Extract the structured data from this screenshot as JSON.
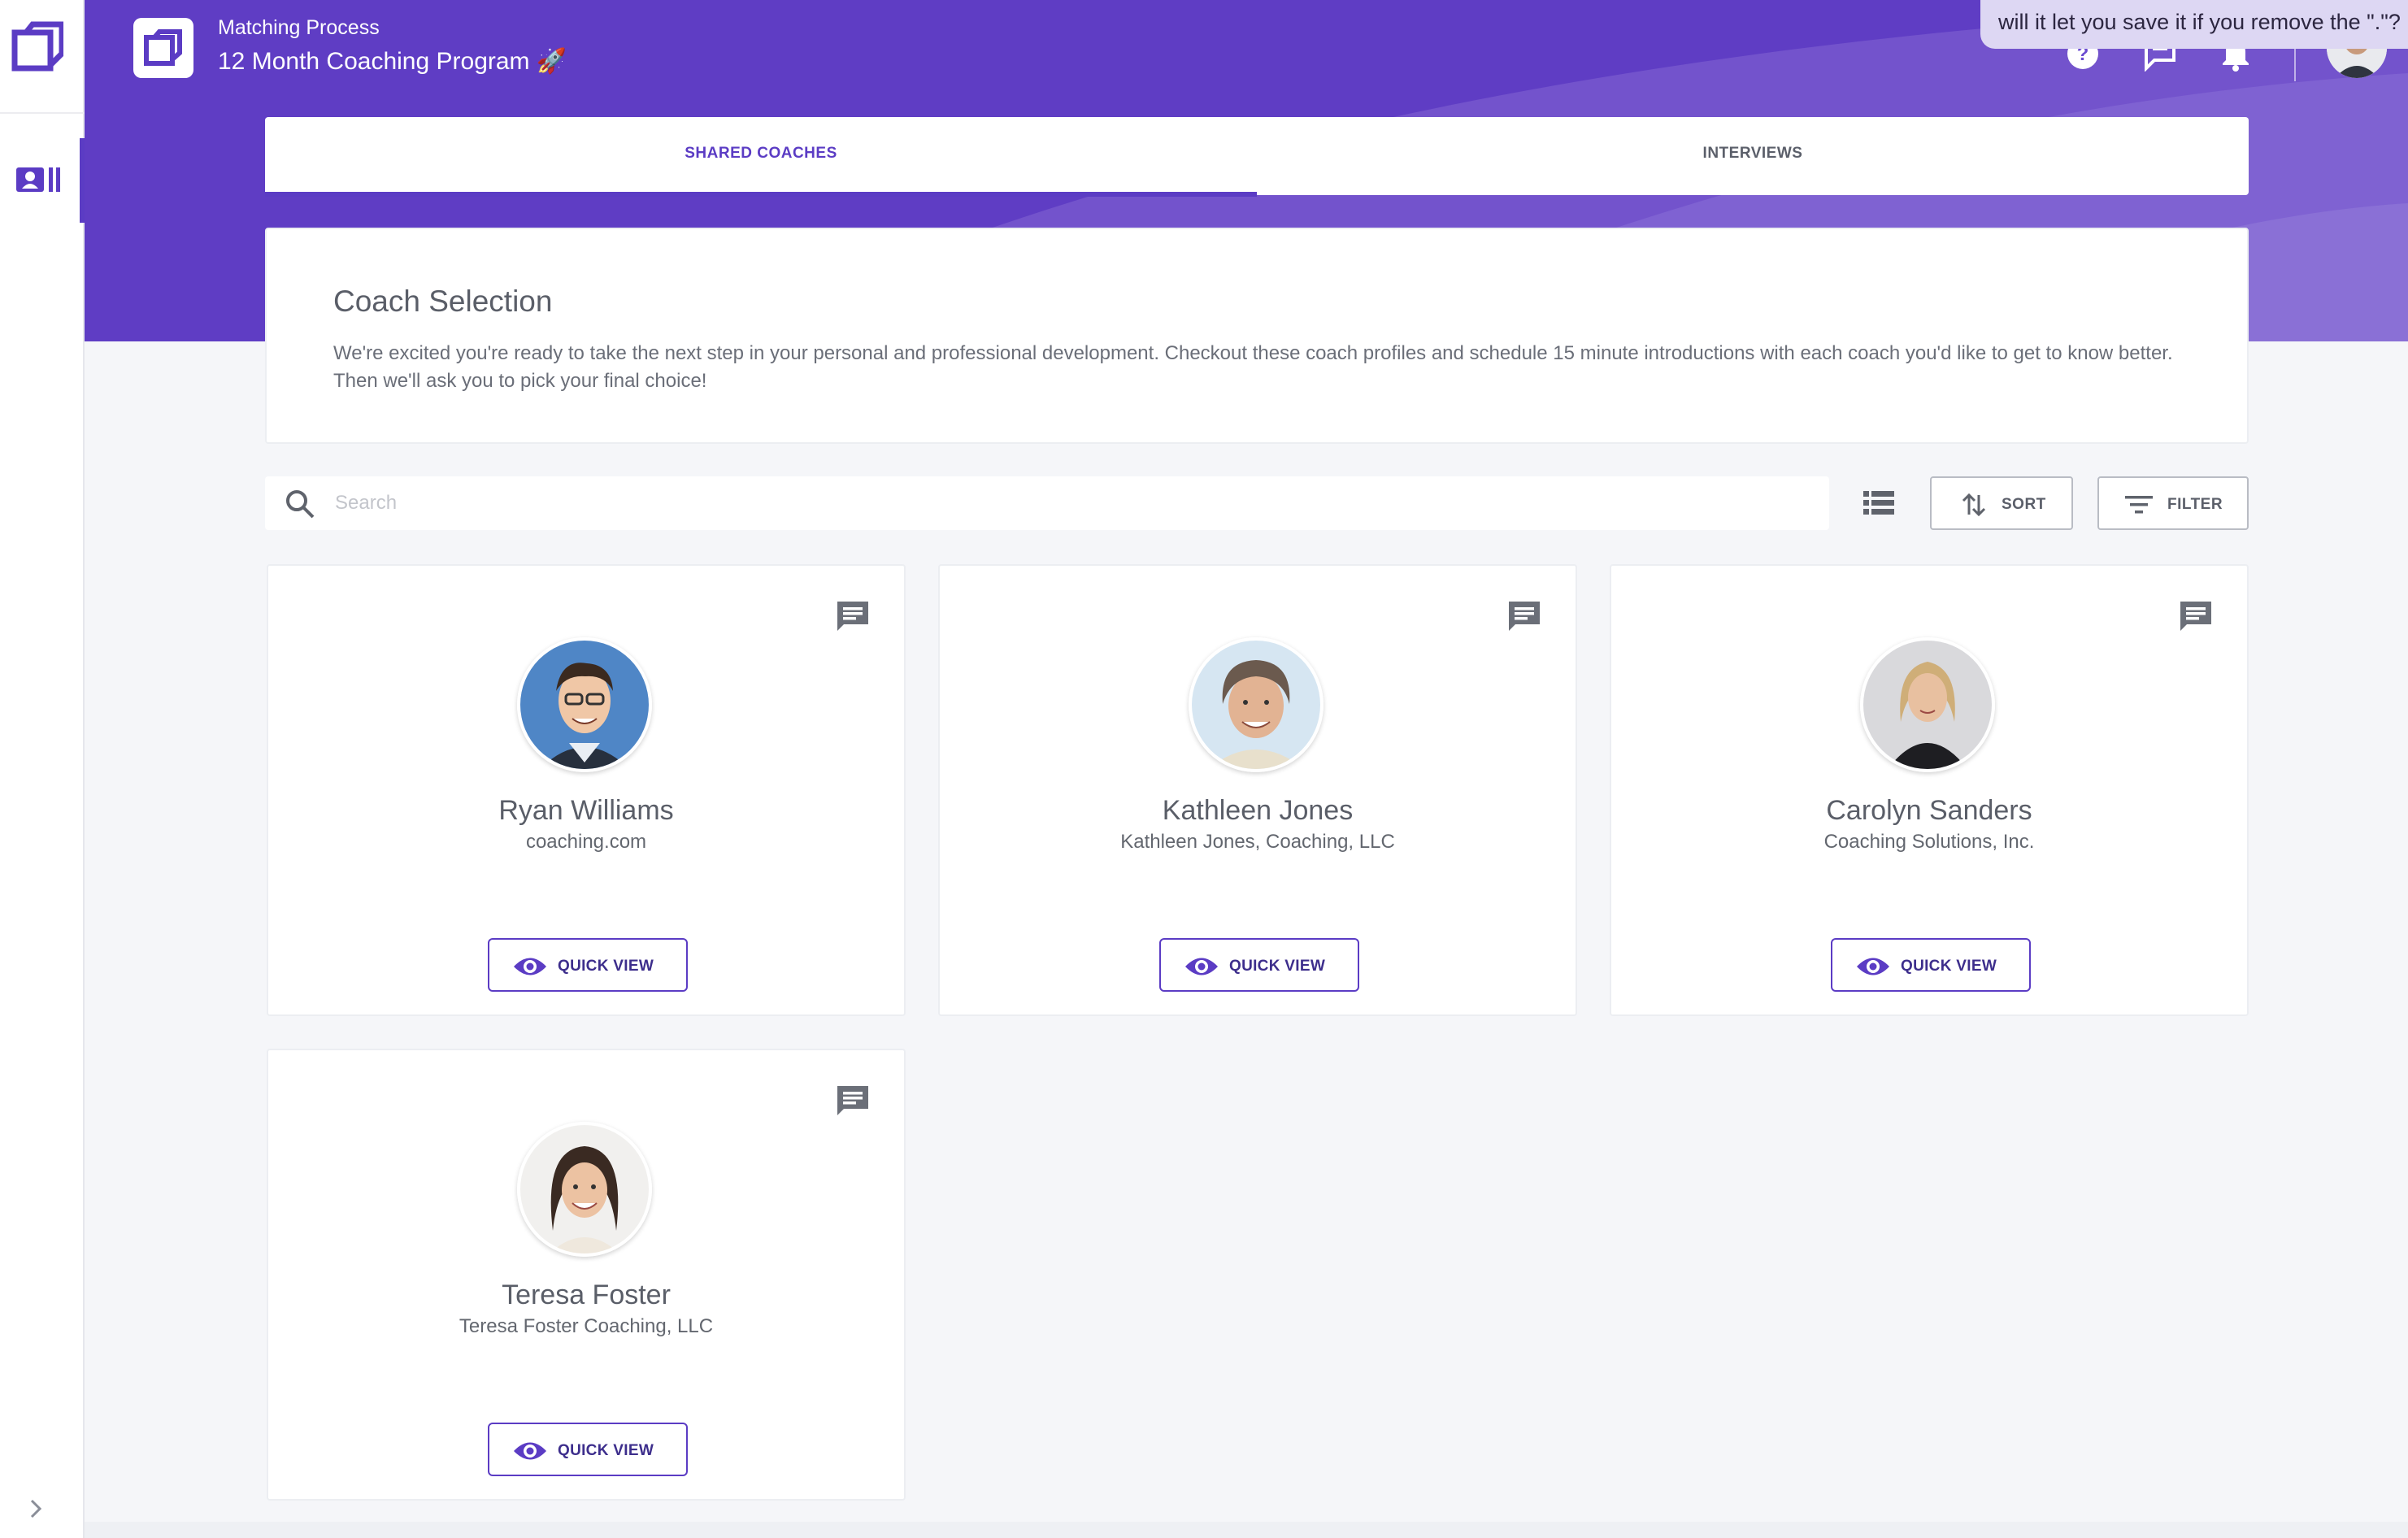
{
  "header": {
    "breadcrumb_sub": "Matching Process",
    "title": "12 Month Coaching Program 🚀",
    "brand_color": "#5f3dc4",
    "icons": [
      "help-icon",
      "chat-icon",
      "bell-icon"
    ]
  },
  "tooltip": {
    "text": "will it let you save it if you remove the \".\"?"
  },
  "tabs": [
    {
      "label": "SHARED COACHES",
      "active": true
    },
    {
      "label": "INTERVIEWS",
      "active": false
    }
  ],
  "intro": {
    "heading": "Coach Selection",
    "body": "We're excited you're ready to take the next step in your personal and professional development. Checkout these coach profiles and schedule 15 minute introductions with each coach you'd like to get to know better. Then we'll ask you to pick your final choice!"
  },
  "toolbar": {
    "search_placeholder": "Search",
    "sort_label": "SORT",
    "filter_label": "FILTER"
  },
  "coaches": [
    {
      "name": "Ryan Williams",
      "company": "coaching.com",
      "quick_view_label": "QUICK VIEW"
    },
    {
      "name": "Kathleen Jones",
      "company": "Kathleen Jones, Coaching, LLC",
      "quick_view_label": "QUICK VIEW"
    },
    {
      "name": "Carolyn Sanders",
      "company": "Coaching Solutions, Inc.",
      "quick_view_label": "QUICK VIEW"
    },
    {
      "name": "Teresa Foster",
      "company": "Teresa Foster Coaching, LLC",
      "quick_view_label": "QUICK VIEW"
    }
  ]
}
